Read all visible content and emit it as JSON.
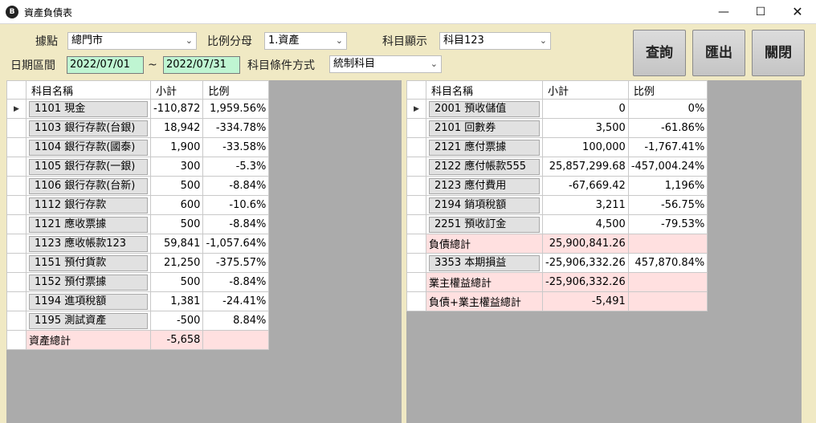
{
  "window": {
    "title": "資產負債表",
    "icon_label": "B"
  },
  "filters": {
    "branch_label": "據點",
    "branch_value": "總門市",
    "ratio_label": "比例分母",
    "ratio_value": "1.資產",
    "account_display_label": "科目顯示",
    "account_display_value": "科目123",
    "date_label": "日期區間",
    "date_from": "2022/07/01",
    "date_sep": "~",
    "date_to": "2022/07/31",
    "condition_label": "科目條件方式",
    "condition_value": "統制科目"
  },
  "buttons": {
    "query": "查詢",
    "export": "匯出",
    "close": "關閉"
  },
  "icons": {
    "minimize": "minimize-icon",
    "maximize": "maximize-icon",
    "close": "close-icon",
    "row_pointer": "triangle-right-icon",
    "dropdown": "chevron-down-icon"
  },
  "colors": {
    "date_bg": "#bff5d2",
    "total_bg": "#ffe0e0",
    "client_bg": "#f0e9c4",
    "grid_bg": "#ababab"
  },
  "assets": {
    "columns": [
      "科目名稱",
      "小計",
      "比例"
    ],
    "rows": [
      {
        "name": "1101 現金",
        "subtotal": "-110,872",
        "ratio": "1,959.56%"
      },
      {
        "name": "1103 銀行存款(台銀)",
        "subtotal": "18,942",
        "ratio": "-334.78%"
      },
      {
        "name": "1104 銀行存款(國泰)",
        "subtotal": "1,900",
        "ratio": "-33.58%"
      },
      {
        "name": "1105 銀行存款(一銀)",
        "subtotal": "300",
        "ratio": "-5.3%"
      },
      {
        "name": "1106 銀行存款(台新)",
        "subtotal": "500",
        "ratio": "-8.84%"
      },
      {
        "name": "1112 銀行存款",
        "subtotal": "600",
        "ratio": "-10.6%"
      },
      {
        "name": "1121 應收票據",
        "subtotal": "500",
        "ratio": "-8.84%"
      },
      {
        "name": "1123 應收帳款123",
        "subtotal": "59,841",
        "ratio": "-1,057.64%"
      },
      {
        "name": "1151 預付貨款",
        "subtotal": "21,250",
        "ratio": "-375.57%"
      },
      {
        "name": "1152 預付票據",
        "subtotal": "500",
        "ratio": "-8.84%"
      },
      {
        "name": "1194 進項稅額",
        "subtotal": "1,381",
        "ratio": "-24.41%"
      },
      {
        "name": "1195 測試資產",
        "subtotal": "-500",
        "ratio": "8.84%"
      }
    ],
    "total": {
      "name": "資產總計",
      "subtotal": "-5,658",
      "ratio": ""
    }
  },
  "liabilities": {
    "columns": [
      "科目名稱",
      "小計",
      "比例"
    ],
    "rows": [
      {
        "name": "2001 預收儲值",
        "subtotal": "0",
        "ratio": "0%"
      },
      {
        "name": "2101 回數券",
        "subtotal": "3,500",
        "ratio": "-61.86%"
      },
      {
        "name": "2121 應付票據",
        "subtotal": "100,000",
        "ratio": "-1,767.41%"
      },
      {
        "name": "2122 應付帳款555",
        "subtotal": "25,857,299.68",
        "ratio": "-457,004.24%"
      },
      {
        "name": "2123 應付費用",
        "subtotal": "-67,669.42",
        "ratio": "1,196%"
      },
      {
        "name": "2194 銷項稅額",
        "subtotal": "3,211",
        "ratio": "-56.75%"
      },
      {
        "name": "2251 預收訂金",
        "subtotal": "4,500",
        "ratio": "-79.53%"
      }
    ],
    "liab_total": {
      "name": "負債總計",
      "subtotal": "25,900,841.26",
      "ratio": ""
    },
    "equity_row": {
      "name": "3353 本期損益",
      "subtotal": "-25,906,332.26",
      "ratio": "457,870.84%"
    },
    "equity_total": {
      "name": "業主權益總計",
      "subtotal": "-25,906,332.26",
      "ratio": ""
    },
    "grand_total": {
      "name": "負債+業主權益總計",
      "subtotal": "-5,491",
      "ratio": ""
    }
  }
}
